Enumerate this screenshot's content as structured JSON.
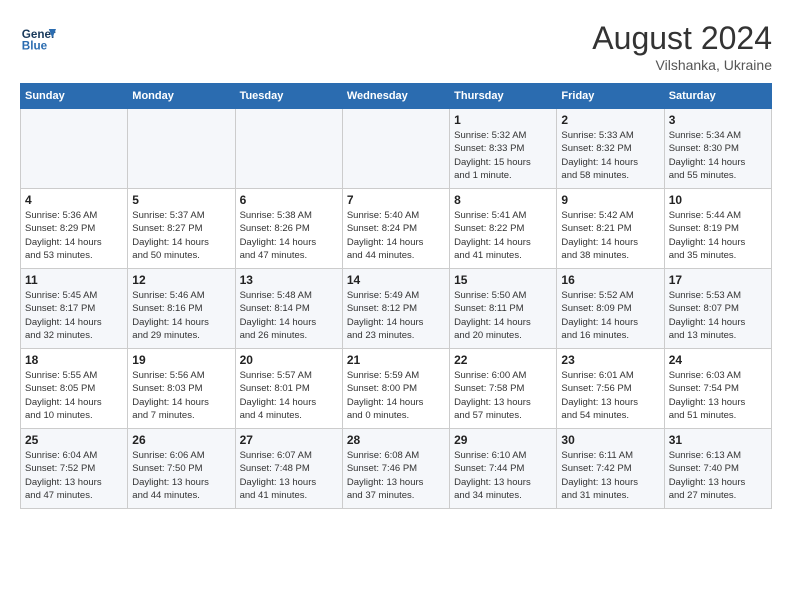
{
  "header": {
    "logo_line1": "General",
    "logo_line2": "Blue",
    "month_year": "August 2024",
    "location": "Vilshanka, Ukraine"
  },
  "weekdays": [
    "Sunday",
    "Monday",
    "Tuesday",
    "Wednesday",
    "Thursday",
    "Friday",
    "Saturday"
  ],
  "weeks": [
    [
      {
        "day": "",
        "info": ""
      },
      {
        "day": "",
        "info": ""
      },
      {
        "day": "",
        "info": ""
      },
      {
        "day": "",
        "info": ""
      },
      {
        "day": "1",
        "info": "Sunrise: 5:32 AM\nSunset: 8:33 PM\nDaylight: 15 hours\nand 1 minute."
      },
      {
        "day": "2",
        "info": "Sunrise: 5:33 AM\nSunset: 8:32 PM\nDaylight: 14 hours\nand 58 minutes."
      },
      {
        "day": "3",
        "info": "Sunrise: 5:34 AM\nSunset: 8:30 PM\nDaylight: 14 hours\nand 55 minutes."
      }
    ],
    [
      {
        "day": "4",
        "info": "Sunrise: 5:36 AM\nSunset: 8:29 PM\nDaylight: 14 hours\nand 53 minutes."
      },
      {
        "day": "5",
        "info": "Sunrise: 5:37 AM\nSunset: 8:27 PM\nDaylight: 14 hours\nand 50 minutes."
      },
      {
        "day": "6",
        "info": "Sunrise: 5:38 AM\nSunset: 8:26 PM\nDaylight: 14 hours\nand 47 minutes."
      },
      {
        "day": "7",
        "info": "Sunrise: 5:40 AM\nSunset: 8:24 PM\nDaylight: 14 hours\nand 44 minutes."
      },
      {
        "day": "8",
        "info": "Sunrise: 5:41 AM\nSunset: 8:22 PM\nDaylight: 14 hours\nand 41 minutes."
      },
      {
        "day": "9",
        "info": "Sunrise: 5:42 AM\nSunset: 8:21 PM\nDaylight: 14 hours\nand 38 minutes."
      },
      {
        "day": "10",
        "info": "Sunrise: 5:44 AM\nSunset: 8:19 PM\nDaylight: 14 hours\nand 35 minutes."
      }
    ],
    [
      {
        "day": "11",
        "info": "Sunrise: 5:45 AM\nSunset: 8:17 PM\nDaylight: 14 hours\nand 32 minutes."
      },
      {
        "day": "12",
        "info": "Sunrise: 5:46 AM\nSunset: 8:16 PM\nDaylight: 14 hours\nand 29 minutes."
      },
      {
        "day": "13",
        "info": "Sunrise: 5:48 AM\nSunset: 8:14 PM\nDaylight: 14 hours\nand 26 minutes."
      },
      {
        "day": "14",
        "info": "Sunrise: 5:49 AM\nSunset: 8:12 PM\nDaylight: 14 hours\nand 23 minutes."
      },
      {
        "day": "15",
        "info": "Sunrise: 5:50 AM\nSunset: 8:11 PM\nDaylight: 14 hours\nand 20 minutes."
      },
      {
        "day": "16",
        "info": "Sunrise: 5:52 AM\nSunset: 8:09 PM\nDaylight: 14 hours\nand 16 minutes."
      },
      {
        "day": "17",
        "info": "Sunrise: 5:53 AM\nSunset: 8:07 PM\nDaylight: 14 hours\nand 13 minutes."
      }
    ],
    [
      {
        "day": "18",
        "info": "Sunrise: 5:55 AM\nSunset: 8:05 PM\nDaylight: 14 hours\nand 10 minutes."
      },
      {
        "day": "19",
        "info": "Sunrise: 5:56 AM\nSunset: 8:03 PM\nDaylight: 14 hours\nand 7 minutes."
      },
      {
        "day": "20",
        "info": "Sunrise: 5:57 AM\nSunset: 8:01 PM\nDaylight: 14 hours\nand 4 minutes."
      },
      {
        "day": "21",
        "info": "Sunrise: 5:59 AM\nSunset: 8:00 PM\nDaylight: 14 hours\nand 0 minutes."
      },
      {
        "day": "22",
        "info": "Sunrise: 6:00 AM\nSunset: 7:58 PM\nDaylight: 13 hours\nand 57 minutes."
      },
      {
        "day": "23",
        "info": "Sunrise: 6:01 AM\nSunset: 7:56 PM\nDaylight: 13 hours\nand 54 minutes."
      },
      {
        "day": "24",
        "info": "Sunrise: 6:03 AM\nSunset: 7:54 PM\nDaylight: 13 hours\nand 51 minutes."
      }
    ],
    [
      {
        "day": "25",
        "info": "Sunrise: 6:04 AM\nSunset: 7:52 PM\nDaylight: 13 hours\nand 47 minutes."
      },
      {
        "day": "26",
        "info": "Sunrise: 6:06 AM\nSunset: 7:50 PM\nDaylight: 13 hours\nand 44 minutes."
      },
      {
        "day": "27",
        "info": "Sunrise: 6:07 AM\nSunset: 7:48 PM\nDaylight: 13 hours\nand 41 minutes."
      },
      {
        "day": "28",
        "info": "Sunrise: 6:08 AM\nSunset: 7:46 PM\nDaylight: 13 hours\nand 37 minutes."
      },
      {
        "day": "29",
        "info": "Sunrise: 6:10 AM\nSunset: 7:44 PM\nDaylight: 13 hours\nand 34 minutes."
      },
      {
        "day": "30",
        "info": "Sunrise: 6:11 AM\nSunset: 7:42 PM\nDaylight: 13 hours\nand 31 minutes."
      },
      {
        "day": "31",
        "info": "Sunrise: 6:13 AM\nSunset: 7:40 PM\nDaylight: 13 hours\nand 27 minutes."
      }
    ]
  ]
}
